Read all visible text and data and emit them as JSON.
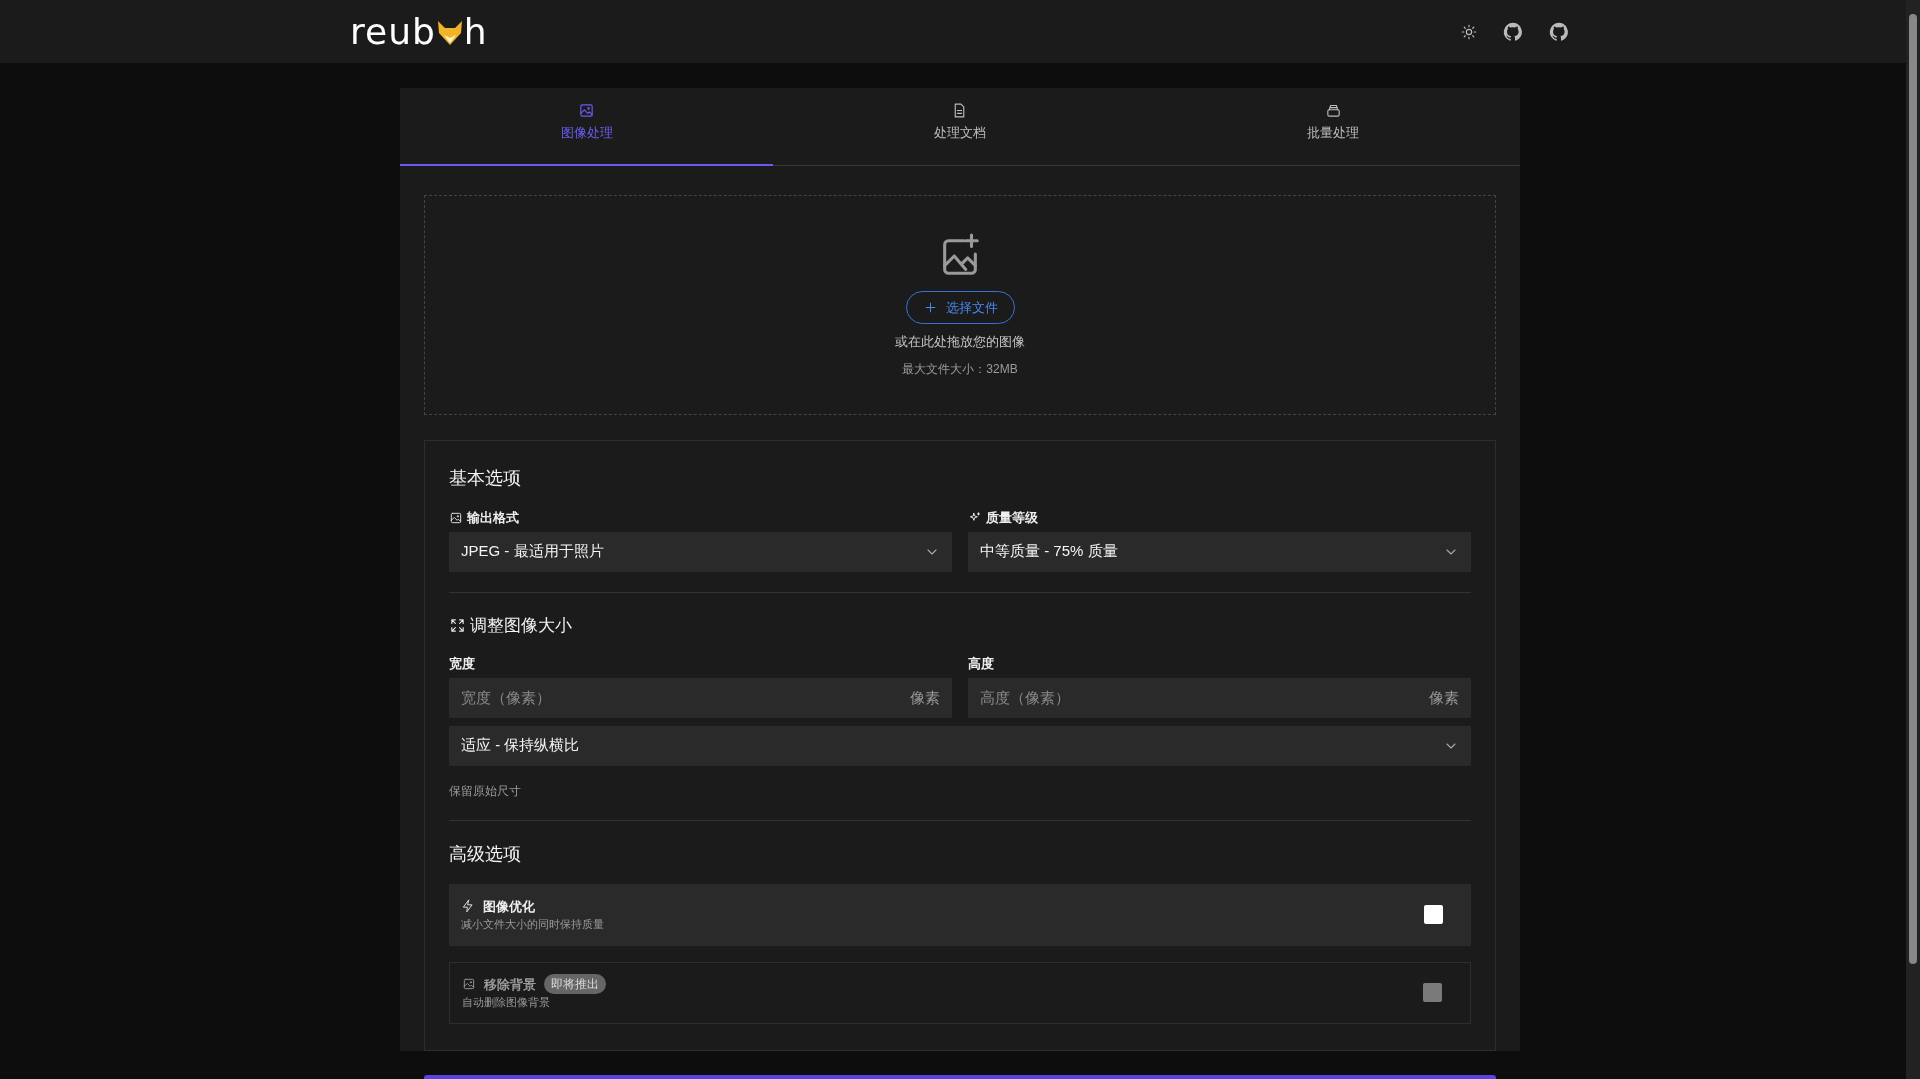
{
  "header": {
    "logo": {
      "before": "reub",
      "after": "h"
    }
  },
  "tabs": [
    {
      "label": "图像处理",
      "selected": true
    },
    {
      "label": "处理文档",
      "selected": false
    },
    {
      "label": "批量处理",
      "selected": false
    }
  ],
  "upload": {
    "button": "选择文件",
    "hint": "或在此处拖放您的图像",
    "limit": "最大文件大小：32MB"
  },
  "basic": {
    "title": "基本选项",
    "format": {
      "label": "输出格式",
      "value": "JPEG - 最适用于照片"
    },
    "quality": {
      "label": "质量等级",
      "value": "中等质量 - 75% 质量"
    }
  },
  "resize": {
    "title": "调整图像大小",
    "width": {
      "label": "宽度",
      "placeholder": "宽度（像素）",
      "unit": "像素"
    },
    "height": {
      "label": "高度",
      "placeholder": "高度（像素）",
      "unit": "像素"
    },
    "mode": "适应 - 保持纵横比",
    "note": "保留原始尺寸"
  },
  "advanced": {
    "title": "高级选项",
    "options": [
      {
        "title": "图像优化",
        "description": "减小文件大小的同时保持质量",
        "checked": false,
        "disabled": false
      },
      {
        "title": "移除背景",
        "badge": "即将推出",
        "description": "自动删除图像背景",
        "checked": false,
        "disabled": true
      }
    ]
  }
}
